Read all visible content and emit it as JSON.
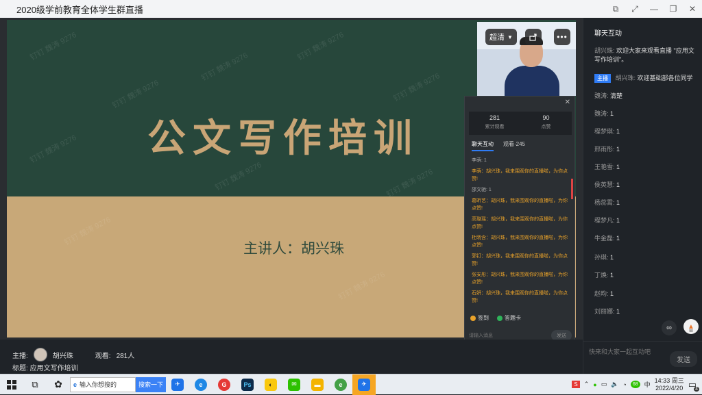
{
  "window": {
    "title": "2020级学前教育全体学生群直播",
    "controls": [
      "⧉",
      "⤢",
      "—",
      "❐",
      "✕"
    ]
  },
  "slide": {
    "headline": "公文写作培训",
    "speaker": "主讲人：胡兴珠",
    "watermark": "钉钉 魏涛 9276",
    "colors": {
      "green": "#27473b",
      "tan": "#c8a878",
      "headline": "#c9a576"
    }
  },
  "camera": {
    "quality_label": "超清",
    "share_icon": "share-icon",
    "more_icon": "more-icon"
  },
  "stats": {
    "viewers_count": "281",
    "viewers_label": "累计观看",
    "likes_count": "90",
    "likes_label": "点赞",
    "tabs": [
      {
        "label": "聊天互动"
      },
      {
        "label": "观看·245"
      }
    ],
    "messages": [
      {
        "text": "李萌: 1",
        "type": "plain"
      },
      {
        "text": "李萌：胡兴珠，我来围观你的直播啦，为你点赞!",
        "type": "orange"
      },
      {
        "text": "邵文驰: 1",
        "type": "plain"
      },
      {
        "text": "葛昕艺：胡兴珠，我来围观你的直播啦，为你点赞!",
        "type": "orange"
      },
      {
        "text": "高璐瑶：胡兴珠，我来围观你的直播啦，为你点赞!",
        "type": "orange"
      },
      {
        "text": "杜晓含：胡兴珠，我来围观你的直播啦，为你点赞!",
        "type": "orange"
      },
      {
        "text": "郭钉：胡兴珠，我来围观你的直播啦，为你点赞!",
        "type": "orange"
      },
      {
        "text": "张安彤：胡兴珠，我来围观你的直播啦，为你点赞!",
        "type": "orange"
      },
      {
        "text": "石妍：胡兴珠，我来围观你的直播啦，为你点赞!",
        "type": "orange"
      }
    ],
    "action_signin": "签到",
    "action_card": "答题卡",
    "input_placeholder": "请输入消息",
    "send_label": "发送"
  },
  "bottom": {
    "host_label": "主播:",
    "host_name": "胡兴珠",
    "viewers_label": "观看:",
    "viewers_value": "281人",
    "title_label": "标题:",
    "title_value": "应用文写作培训"
  },
  "chat": {
    "header": "聊天互动",
    "messages": [
      {
        "user": "胡兴珠:",
        "text": "欢迎大家来观看直播 \"应用文写作培训\"。"
      },
      {
        "badge": "主播",
        "user": "胡兴珠:",
        "text": "欢迎基础部各位同学"
      },
      {
        "user": "魏涛:",
        "text": "清楚"
      },
      {
        "user": "魏涛:",
        "text": "1"
      },
      {
        "user": "程梦琪:",
        "text": "1"
      },
      {
        "user": "邢雨彤:",
        "text": "1"
      },
      {
        "user": "王艳雪:",
        "text": "1"
      },
      {
        "user": "侯英慧:",
        "text": "1"
      },
      {
        "user": "杨蕊霄:",
        "text": "1"
      },
      {
        "user": "程梦凡:",
        "text": "1"
      },
      {
        "user": "牛金磊:",
        "text": "1"
      },
      {
        "user": "孙琪:",
        "text": "1"
      },
      {
        "user": "丁焕:",
        "text": "1"
      },
      {
        "user": "赵昀:",
        "text": "1"
      },
      {
        "user": "刘丽娜:",
        "text": "1"
      }
    ],
    "like_count": "90",
    "input_placeholder": "快来和大家一起互动吧",
    "send_label": "发送"
  },
  "taskbar": {
    "search_placeholder": "输入你想搜的",
    "search_button": "搜索一下",
    "time": "14:33 周三",
    "date": "2022/4/20",
    "notification_count": "4",
    "battery_badge": "68"
  }
}
